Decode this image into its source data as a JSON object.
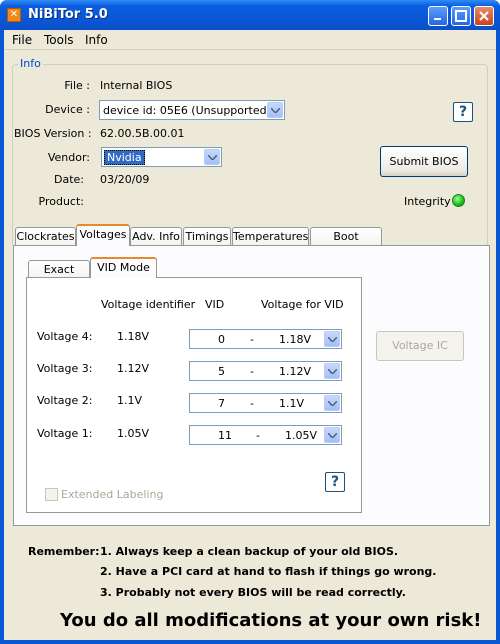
{
  "window": {
    "title": "NiBiTor 5.0"
  },
  "menu": {
    "file": "File",
    "tools": "Tools",
    "info": "Info"
  },
  "info": {
    "legend": "Info",
    "file_label": "File :",
    "file_value": "Internal BIOS",
    "device_label": "Device :",
    "device_value": "device id: 05E6 (Unsupported)",
    "bios_version_label": "BIOS Version :",
    "bios_version_value": "62.00.5B.00.01",
    "vendor_label": "Vendor:",
    "vendor_value": "Nvidia",
    "date_label": "Date:",
    "date_value": "03/20/09",
    "product_label": "Product:",
    "submit_button": "Submit BIOS",
    "integrity_label": "Integrity :",
    "integrity_status_color": "#10c010"
  },
  "tabs": [
    "Clockrates",
    "Voltages",
    "Adv. Info",
    "Timings",
    "Temperatures",
    "Boot Settings"
  ],
  "active_tab": "Voltages",
  "subtabs": [
    "Exact Mode",
    "VID Mode"
  ],
  "active_subtab": "VID Mode",
  "voltages": {
    "headers": {
      "identifier": "Voltage identifier",
      "vid": "VID",
      "for_vid": "Voltage for VID"
    },
    "rows": [
      {
        "label": "Voltage 4:",
        "identifier": "1.18V",
        "vid": "0",
        "sep": "-",
        "value": "1.18V"
      },
      {
        "label": "Voltage 3:",
        "identifier": "1.12V",
        "vid": "5",
        "sep": "-",
        "value": "1.12V"
      },
      {
        "label": "Voltage 2:",
        "identifier": "1.1V",
        "vid": "7",
        "sep": "-",
        "value": "1.1V"
      },
      {
        "label": "Voltage 1:",
        "identifier": "1.05V",
        "vid": "11",
        "sep": "-",
        "value": "1.05V"
      }
    ],
    "extended_labeling": "Extended Labeling",
    "voltage_ic_button": "Voltage IC"
  },
  "remember": {
    "label": "Remember:",
    "lines": [
      "1. Always keep a clean backup of your old BIOS.",
      "2. Have a PCI card at hand to flash if things go wrong.",
      "3. Probably not every BIOS will be read correctly."
    ]
  },
  "warning": "You do all modifications at your own risk!"
}
